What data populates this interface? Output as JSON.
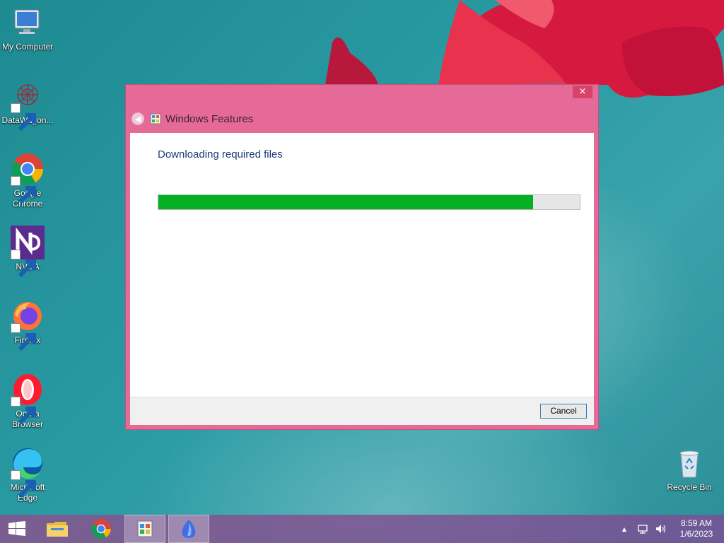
{
  "desktop": {
    "icons": [
      {
        "label": "My Computer"
      },
      {
        "label": "DataWagon..."
      },
      {
        "label": "Google Chrome"
      },
      {
        "label": "NVDA"
      },
      {
        "label": "Firefox"
      },
      {
        "label": "Opera Browser"
      },
      {
        "label": "Microsoft Edge"
      },
      {
        "label": "Recycle Bin"
      }
    ]
  },
  "dialog": {
    "title": "Windows Features",
    "close_label": "×",
    "heading": "Downloading required files",
    "progress": 0.89,
    "cancel_label": "Cancel",
    "accent_color": "#e56a98",
    "progress_color": "#06b025"
  },
  "taskbar": {
    "items": [
      "start-icon",
      "file-explorer-icon",
      "chrome-icon",
      "windows-features-icon",
      "blue-app-icon"
    ],
    "tray": {
      "arrow": "▲",
      "time": "8:59 AM",
      "date": "1/6/2023"
    }
  }
}
